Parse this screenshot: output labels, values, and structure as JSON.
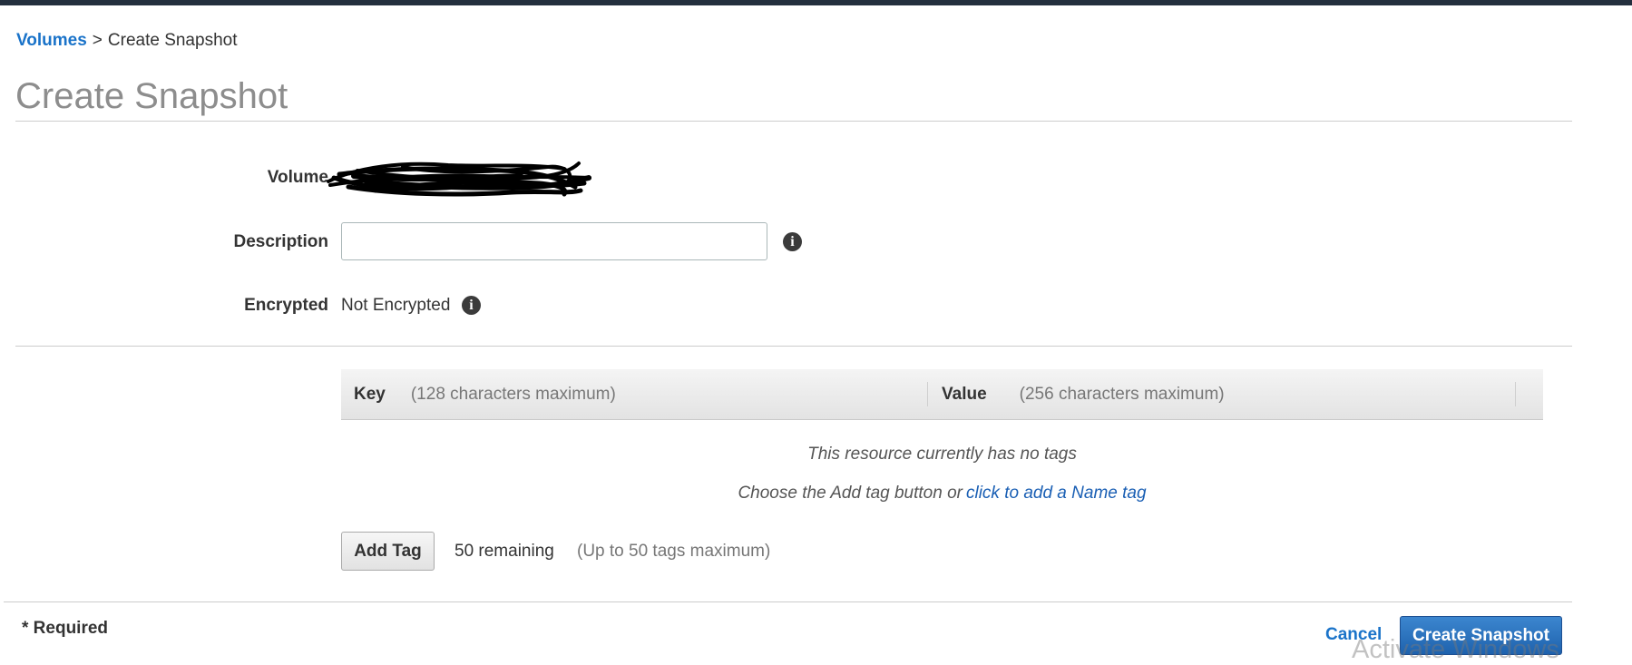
{
  "breadcrumb": {
    "parent": "Volumes",
    "separator": ">",
    "current": "Create Snapshot"
  },
  "page_title": "Create Snapshot",
  "form": {
    "volume_label": "Volume",
    "description_label": "Description",
    "description_value": "",
    "encrypted_label": "Encrypted",
    "encrypted_value": "Not Encrypted"
  },
  "tags": {
    "key_header": "Key",
    "key_hint": "(128 characters maximum)",
    "value_header": "Value",
    "value_hint": "(256 characters maximum)",
    "empty_message": "This resource currently has no tags",
    "choose_text": "Choose the Add tag button or",
    "name_tag_link": "click to add a Name tag",
    "add_tag_label": "Add Tag",
    "remaining": "50 remaining",
    "limit": "(Up to 50 tags maximum)"
  },
  "footer": {
    "required_note": "* Required",
    "cancel_label": "Cancel",
    "create_label": "Create Snapshot"
  },
  "icons": {
    "info": "info-icon"
  },
  "watermark": "Activate Windows",
  "colors": {
    "link": "#1a73c9",
    "primary_button": "#1e62ad",
    "top_bar": "#232f3e"
  }
}
